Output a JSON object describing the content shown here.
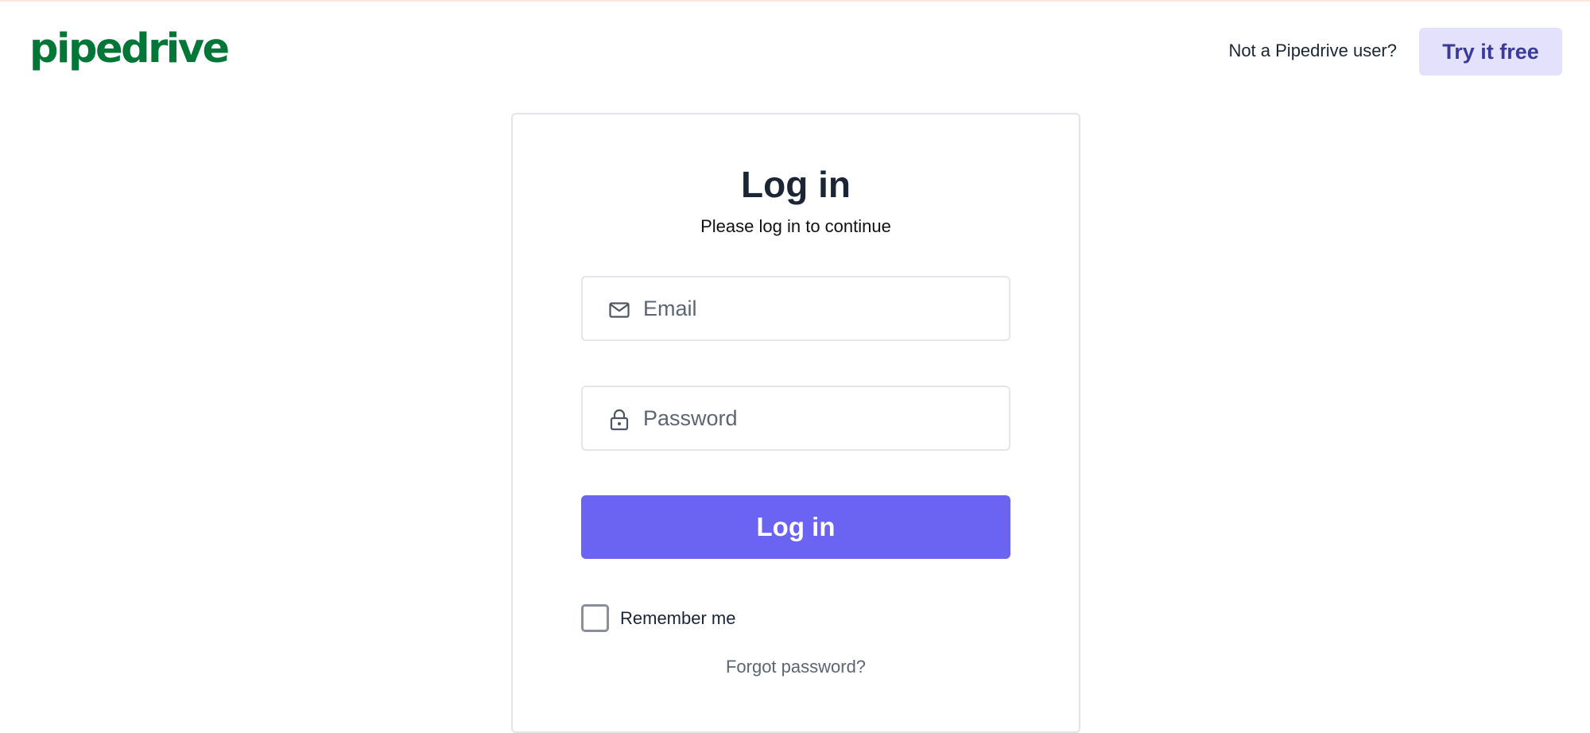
{
  "header": {
    "logo_text": "pipedrive",
    "logo_color": "#017737",
    "not_user_text": "Not a Pipedrive user?",
    "try_button_label": "Try it free"
  },
  "login_card": {
    "title": "Log in",
    "subtitle": "Please log in to continue",
    "email": {
      "value": "",
      "placeholder": "Email",
      "icon": "envelope-icon"
    },
    "password": {
      "value": "",
      "placeholder": "Password",
      "icon": "lock-icon"
    },
    "login_button_label": "Log in",
    "remember_me": {
      "label": "Remember me",
      "checked": false
    },
    "forgot_password_label": "Forgot password?"
  },
  "colors": {
    "accent": "#6b63f2",
    "try_button_bg": "#e3e1fb",
    "try_button_text": "#3a3a9d",
    "text": "#1b2536",
    "muted": "#5d6473"
  }
}
